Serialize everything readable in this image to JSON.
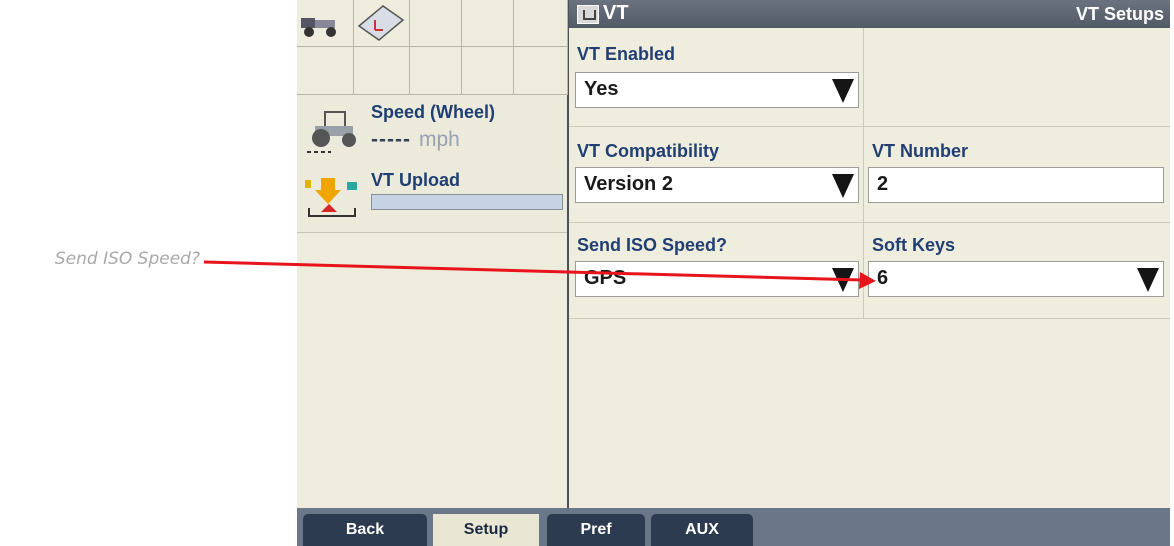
{
  "annotation": {
    "text": "Send ISO Speed?"
  },
  "header": {
    "title": "VT",
    "right_title": "VT Setups"
  },
  "left_panel": {
    "speed_tile": {
      "title": "Speed (Wheel)",
      "value": "-----",
      "unit": "mph"
    },
    "upload_tile": {
      "title": "VT Upload",
      "progress": 0
    }
  },
  "settings": {
    "vt_enabled": {
      "label": "VT Enabled",
      "value": "Yes"
    },
    "vt_compatibility": {
      "label": "VT Compatibility",
      "value": "Version 2"
    },
    "vt_number": {
      "label": "VT Number",
      "value": "2"
    },
    "send_iso_speed": {
      "label": "Send ISO Speed?",
      "value": "GPS"
    },
    "soft_keys": {
      "label": "Soft Keys",
      "value": "6"
    }
  },
  "tabs": [
    {
      "label": "Back"
    },
    {
      "label": "Setup",
      "active": true
    },
    {
      "label": "Pref"
    },
    {
      "label": "AUX"
    }
  ],
  "colors": {
    "arrow": "#e8141b",
    "label": "#213f73",
    "background": "#e9e7d4",
    "tab_dark": "#2c3b50"
  }
}
